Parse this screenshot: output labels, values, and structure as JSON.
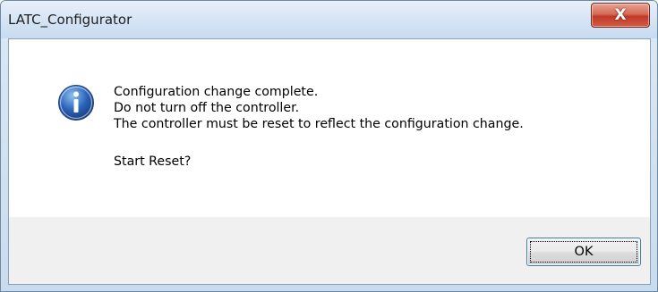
{
  "window": {
    "title": "LATC_Configurator",
    "close_label": "X"
  },
  "dialog": {
    "icon": "information-icon",
    "lines": [
      "Configuration change complete.",
      "Do not turn off the controller.",
      "The controller must be reset to reflect the configuration change."
    ],
    "question": "Start Reset?",
    "ok_label": "OK"
  },
  "colors": {
    "close_button": "#c0392b",
    "info_icon": "#2a62b8",
    "focus_border": "#3c7fb1"
  }
}
